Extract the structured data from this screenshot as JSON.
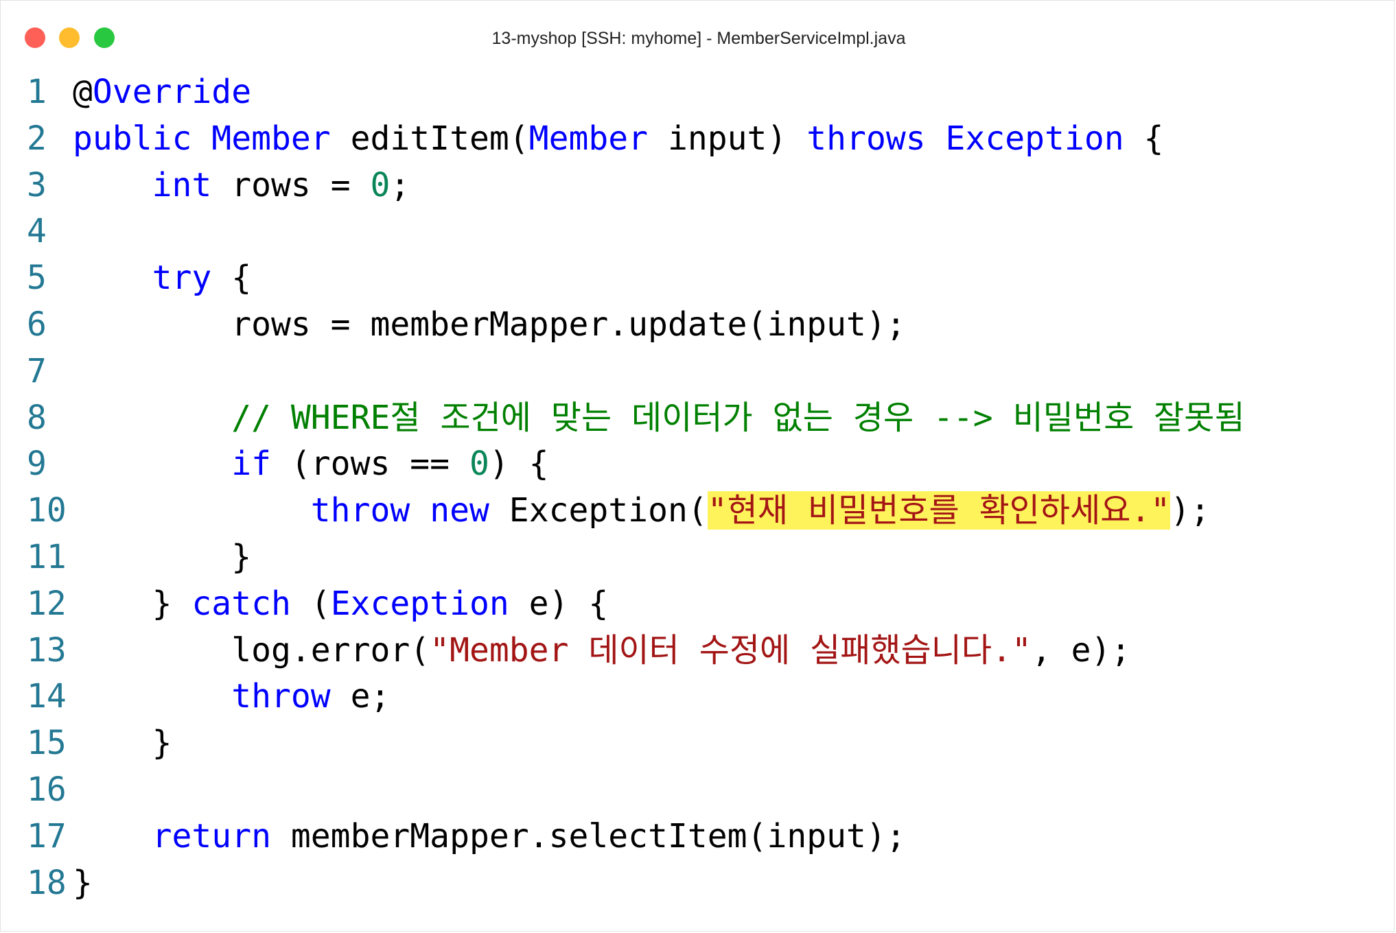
{
  "window": {
    "title": "13-myshop [SSH: myhome] - MemberServiceImpl.java"
  },
  "colors": {
    "keyword": "#0000ff",
    "number": "#098658",
    "string": "#a31515",
    "comment": "#008000",
    "line_number": "#237893",
    "highlight": "#fff35c",
    "traffic_close": "#fe5f57",
    "traffic_minimize": "#febc2e",
    "traffic_maximize": "#28c840"
  },
  "code": {
    "language": "java",
    "lines": [
      {
        "n": "1",
        "tokens": [
          {
            "t": "@",
            "c": "txt"
          },
          {
            "t": "Override",
            "c": "ann"
          }
        ]
      },
      {
        "n": "2",
        "tokens": [
          {
            "t": "public",
            "c": "kw"
          },
          {
            "t": " ",
            "c": "txt"
          },
          {
            "t": "Member",
            "c": "typ"
          },
          {
            "t": " editItem(",
            "c": "txt"
          },
          {
            "t": "Member",
            "c": "typ"
          },
          {
            "t": " input) ",
            "c": "txt"
          },
          {
            "t": "throws",
            "c": "kw"
          },
          {
            "t": " ",
            "c": "txt"
          },
          {
            "t": "Exception",
            "c": "typ"
          },
          {
            "t": " {",
            "c": "txt"
          }
        ]
      },
      {
        "n": "3",
        "tokens": [
          {
            "t": "    ",
            "c": "txt"
          },
          {
            "t": "int",
            "c": "kw"
          },
          {
            "t": " rows = ",
            "c": "txt"
          },
          {
            "t": "0",
            "c": "num"
          },
          {
            "t": ";",
            "c": "txt"
          }
        ]
      },
      {
        "n": "4",
        "tokens": []
      },
      {
        "n": "5",
        "tokens": [
          {
            "t": "    ",
            "c": "txt"
          },
          {
            "t": "try",
            "c": "kw"
          },
          {
            "t": " {",
            "c": "txt"
          }
        ]
      },
      {
        "n": "6",
        "tokens": [
          {
            "t": "        rows = memberMapper.update(input);",
            "c": "txt"
          }
        ]
      },
      {
        "n": "7",
        "tokens": []
      },
      {
        "n": "8",
        "tokens": [
          {
            "t": "        ",
            "c": "txt"
          },
          {
            "t": "// WHERE절 조건에 맞는 데이터가 없는 경우 --> 비밀번호 잘못됨",
            "c": "cmt"
          }
        ]
      },
      {
        "n": "9",
        "tokens": [
          {
            "t": "        ",
            "c": "txt"
          },
          {
            "t": "if",
            "c": "kw"
          },
          {
            "t": " (rows == ",
            "c": "txt"
          },
          {
            "t": "0",
            "c": "num"
          },
          {
            "t": ") {",
            "c": "txt"
          }
        ]
      },
      {
        "n": "10",
        "tokens": [
          {
            "t": "            ",
            "c": "txt"
          },
          {
            "t": "throw",
            "c": "kw"
          },
          {
            "t": " ",
            "c": "txt"
          },
          {
            "t": "new",
            "c": "kw"
          },
          {
            "t": " Exception(",
            "c": "txt"
          },
          {
            "t": "\"현재 비밀번호를 확인하세요.\"",
            "c": "str hl"
          },
          {
            "t": ");",
            "c": "txt"
          }
        ]
      },
      {
        "n": "11",
        "tokens": [
          {
            "t": "        }",
            "c": "txt"
          }
        ]
      },
      {
        "n": "12",
        "tokens": [
          {
            "t": "    } ",
            "c": "txt"
          },
          {
            "t": "catch",
            "c": "kw"
          },
          {
            "t": " (",
            "c": "txt"
          },
          {
            "t": "Exception",
            "c": "typ"
          },
          {
            "t": " e) {",
            "c": "txt"
          }
        ]
      },
      {
        "n": "13",
        "tokens": [
          {
            "t": "        log.error(",
            "c": "txt"
          },
          {
            "t": "\"Member 데이터 수정에 실패했습니다.\"",
            "c": "str"
          },
          {
            "t": ", e);",
            "c": "txt"
          }
        ]
      },
      {
        "n": "14",
        "tokens": [
          {
            "t": "        ",
            "c": "txt"
          },
          {
            "t": "throw",
            "c": "kw"
          },
          {
            "t": " e;",
            "c": "txt"
          }
        ]
      },
      {
        "n": "15",
        "tokens": [
          {
            "t": "    }",
            "c": "txt"
          }
        ]
      },
      {
        "n": "16",
        "tokens": []
      },
      {
        "n": "17",
        "tokens": [
          {
            "t": "    ",
            "c": "txt"
          },
          {
            "t": "return",
            "c": "kw"
          },
          {
            "t": " memberMapper.selectItem(input);",
            "c": "txt"
          }
        ]
      },
      {
        "n": "18",
        "tokens": [
          {
            "t": "}",
            "c": "txt"
          }
        ]
      }
    ]
  }
}
